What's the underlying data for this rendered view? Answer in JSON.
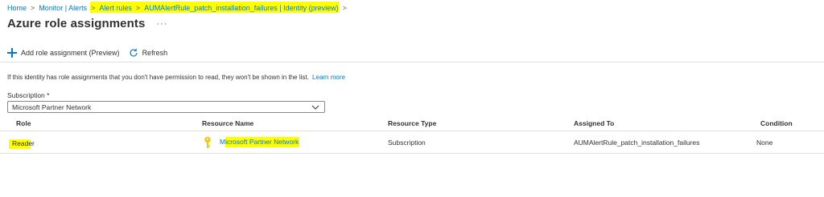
{
  "breadcrumb": {
    "items": [
      "Home",
      "Monitor | Alerts",
      "Alert rules",
      "AUMAlertRule_patch_installation_failures | Identity (preview)"
    ],
    "separator": ">"
  },
  "header": {
    "title": "Azure role assignments",
    "more": "···"
  },
  "toolbar": {
    "add_label": "Add role assignment (Preview)",
    "refresh_label": "Refresh"
  },
  "info": {
    "text": "If this identity has role assignments that you don't have permission to read, they won't be shown in the list.",
    "link": "Learn more"
  },
  "subscription": {
    "label": "Subscription *",
    "value": "Microsoft Partner Network"
  },
  "table": {
    "columns": [
      "Role",
      "Resource Name",
      "Resource Type",
      "Assigned To",
      "Condition"
    ],
    "rows": [
      {
        "role": "Reader",
        "resource_name": "Microsoft Partner Network",
        "resource_type": "Subscription",
        "assigned_to": "AUMAlertRule_patch_installation_failures",
        "condition": "None"
      }
    ]
  },
  "colors": {
    "accent": "#0078d4",
    "highlight": "#ffff00",
    "text": "#323130",
    "border": "#e1dfdd"
  }
}
